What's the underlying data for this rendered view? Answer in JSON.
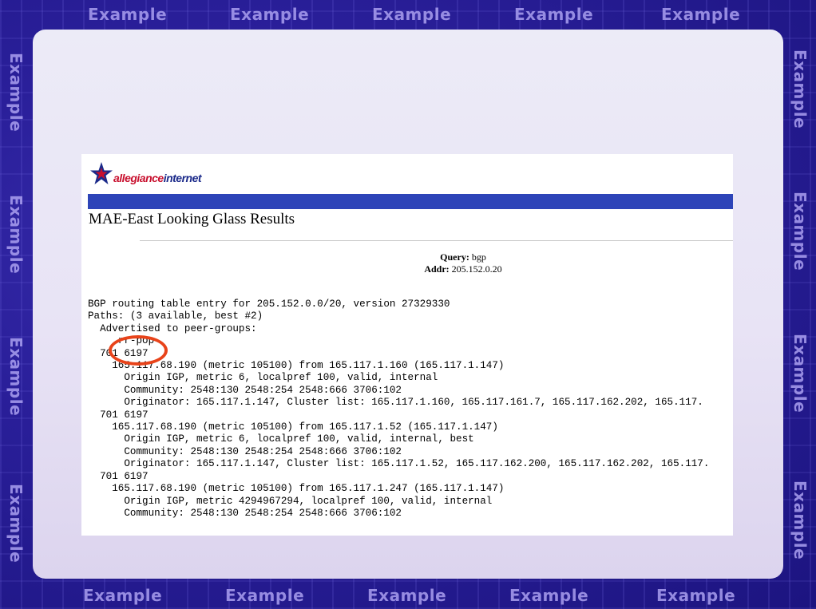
{
  "watermark_text": "Example",
  "screenshot": {
    "logo_text_part1": "allegiance",
    "logo_text_part2": "internet",
    "page_title": "MAE-East Looking Glass Results",
    "query_label": "Query:",
    "query_value": "bgp",
    "addr_label": "Addr:",
    "addr_value": "205.152.0.20",
    "output_lines": [
      "BGP routing table entry for 205.152.0.0/20, version 27329330",
      "Paths: (3 available, best #2)",
      "  Advertised to peer-groups:",
      "     rr-pop",
      "  701 6197",
      "    165.117.68.190 (metric 105100) from 165.117.1.160 (165.117.1.147)",
      "      Origin IGP, metric 6, localpref 100, valid, internal",
      "      Community: 2548:130 2548:254 2548:666 3706:102",
      "      Originator: 165.117.1.147, Cluster list: 165.117.1.160, 165.117.161.7, 165.117.162.202, 165.117.",
      "  701 6197",
      "    165.117.68.190 (metric 105100) from 165.117.1.52 (165.117.1.147)",
      "      Origin IGP, metric 6, localpref 100, valid, internal, best",
      "      Community: 2548:130 2548:254 2548:666 3706:102",
      "      Originator: 165.117.1.147, Cluster list: 165.117.1.52, 165.117.162.200, 165.117.162.202, 165.117.",
      "  701 6197",
      "    165.117.68.190 (metric 105100) from 165.117.1.247 (165.117.1.147)",
      "      Origin IGP, metric 4294967294, localpref 100, valid, internal",
      "      Community: 2548:130 2548:254 2548:666 3706:102"
    ]
  },
  "colors": {
    "highlight_circle": "#e8431a",
    "blue_bar": "#2d44b8",
    "logo_red": "#c8102e",
    "logo_blue": "#1b2a8a"
  }
}
